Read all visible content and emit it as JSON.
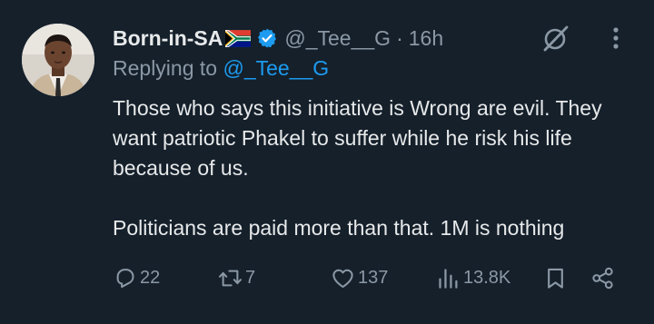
{
  "tweet": {
    "display_name": "Born-in-SA",
    "handle": "@_Tee__G",
    "separator": "·",
    "time": "16h",
    "replying_prefix": "Replying to",
    "replying_to": "@_Tee__G",
    "paragraph_1": "Those who says this initiative is Wrong are evil. They want patriotic Phakel to suffer while he risk his life because of us.",
    "paragraph_2": "Politicians are paid more than that. 1M is nothing"
  },
  "metrics": {
    "replies": "22",
    "reposts": "7",
    "likes": "137",
    "views": "13.8K"
  },
  "icons": {
    "verified": "verified-badge-icon",
    "flag": "south-africa-flag-icon",
    "grok": "grok-icon",
    "more": "more-icon",
    "reply": "reply-icon",
    "repost": "repost-icon",
    "like": "heart-icon",
    "views": "views-icon",
    "bookmark": "bookmark-icon",
    "share": "share-icon"
  },
  "colors": {
    "background": "#15202b",
    "text": "#e7e9ea",
    "muted": "#8b98a5",
    "accent": "#1d9bf0"
  }
}
